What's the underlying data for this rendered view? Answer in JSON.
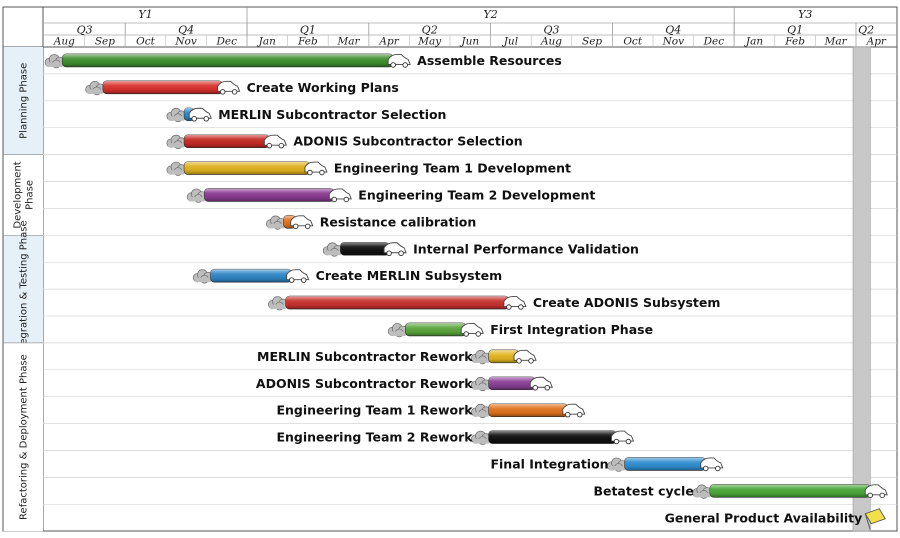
{
  "chart_data": {
    "type": "gantt",
    "years": [
      {
        "label": "Y1",
        "start": 0,
        "end": 5
      },
      {
        "label": "Y2",
        "start": 5,
        "end": 17
      },
      {
        "label": "Y3",
        "start": 17,
        "end": 20.5
      }
    ],
    "quarters": [
      {
        "label": "Q3",
        "start": 0,
        "end": 2
      },
      {
        "label": "Q4",
        "start": 2,
        "end": 5
      },
      {
        "label": "Q1",
        "start": 5,
        "end": 8
      },
      {
        "label": "Q2",
        "start": 8,
        "end": 11
      },
      {
        "label": "Q3",
        "start": 11,
        "end": 14
      },
      {
        "label": "Q4",
        "start": 14,
        "end": 17
      },
      {
        "label": "Q1",
        "start": 17,
        "end": 20
      },
      {
        "label": "Q2",
        "start": 20,
        "end": 20.5
      }
    ],
    "months": [
      "Aug",
      "Sep",
      "Oct",
      "Nov",
      "Dec",
      "Jan",
      "Feb",
      "Mar",
      "Apr",
      "May",
      "Jun",
      "Jul",
      "Aug",
      "Sep",
      "Oct",
      "Nov",
      "Dec",
      "Jan",
      "Feb",
      "Mar",
      "Apr"
    ],
    "phases": [
      {
        "label": "Planning Phase",
        "rows": [
          0,
          3
        ]
      },
      {
        "label": "Development Phase",
        "rows": [
          4,
          6
        ]
      },
      {
        "label": "Integration & Testing Phase",
        "rows": [
          7,
          10
        ]
      },
      {
        "label": "Refactoring & Deployment Phase",
        "rows": [
          11,
          17
        ]
      }
    ],
    "tasks": [
      {
        "name": "Assemble Resources",
        "start": 0.45,
        "end": 8.6,
        "color": "#3f8f2e",
        "label_side": "right"
      },
      {
        "name": "Create Working Plans",
        "start": 1.45,
        "end": 4.4,
        "color": "#d9302c",
        "label_side": "right"
      },
      {
        "name": "MERLIN Subcontractor Selection",
        "start": 3.45,
        "end": 3.7,
        "color": "#2a86c8",
        "label_side": "right"
      },
      {
        "name": "ADONIS Subcontractor Selection",
        "start": 3.45,
        "end": 5.55,
        "color": "#c52a25",
        "label_side": "right"
      },
      {
        "name": "Engineering Team 1 Development",
        "start": 3.45,
        "end": 6.55,
        "color": "#e0b11d",
        "label_side": "right"
      },
      {
        "name": "Engineering Team 2 Development",
        "start": 3.95,
        "end": 7.15,
        "color": "#8a3a92",
        "label_side": "right"
      },
      {
        "name": "Resistance calibration",
        "start": 5.9,
        "end": 6.2,
        "color": "#e0741e",
        "label_side": "right"
      },
      {
        "name": "Internal Performance Validation",
        "start": 7.3,
        "end": 8.5,
        "color": "#111111",
        "label_side": "right"
      },
      {
        "name": "Create MERLIN Subsystem",
        "start": 4.1,
        "end": 6.1,
        "color": "#2f86c6",
        "label_side": "right"
      },
      {
        "name": "Create ADONIS Subsystem",
        "start": 5.95,
        "end": 11.45,
        "color": "#c8302c",
        "label_side": "right"
      },
      {
        "name": "First Integration Phase",
        "start": 8.9,
        "end": 10.4,
        "color": "#5aa63c",
        "label_side": "right"
      },
      {
        "name": "MERLIN Subcontractor Rework",
        "start": 10.95,
        "end": 11.7,
        "color": "#e2b51e",
        "label_side": "left"
      },
      {
        "name": "ADONIS Subcontractor Rework",
        "start": 10.95,
        "end": 12.1,
        "color": "#8a3f95",
        "label_side": "left"
      },
      {
        "name": "Engineering Team 1 Rework",
        "start": 10.95,
        "end": 12.9,
        "color": "#e0721c",
        "label_side": "left"
      },
      {
        "name": "Engineering Team 2 Rework",
        "start": 10.95,
        "end": 14.1,
        "color": "#111111",
        "label_side": "left"
      },
      {
        "name": "Final Integration",
        "start": 14.3,
        "end": 16.3,
        "color": "#2f8ed0",
        "label_side": "left"
      },
      {
        "name": "Betatest cycle",
        "start": 16.4,
        "end": 20.35,
        "color": "#4aa83a",
        "label_side": "left"
      },
      {
        "name": "General Product Availability",
        "start": 20.45,
        "end": 20.45,
        "color": "#f2e04a",
        "label_side": "left",
        "milestone": true
      }
    ],
    "today_marker": {
      "start": 20.0,
      "end": 20.5
    }
  }
}
